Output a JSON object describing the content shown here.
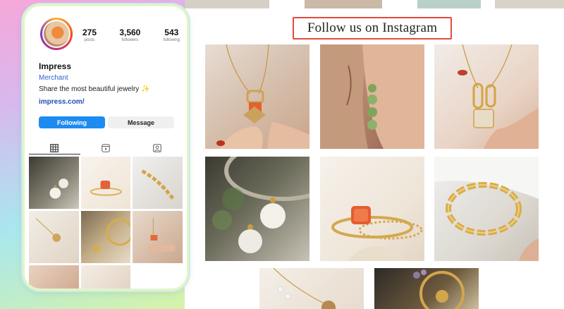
{
  "profile": {
    "stats": [
      {
        "value": "275",
        "label": "posts"
      },
      {
        "value": "3,560",
        "label": "followers"
      },
      {
        "value": "543",
        "label": "following"
      }
    ],
    "name": "Impress",
    "category": "Merchant",
    "bio": "Share the most beautiful jewelry",
    "bio_emoji": "✨",
    "link": "impress.com/",
    "buttons": {
      "following": "Following",
      "message": "Message"
    },
    "tabs": [
      {
        "icon": "grid-icon",
        "active": true
      },
      {
        "icon": "reels-icon",
        "active": false
      },
      {
        "icon": "tagged-icon",
        "active": false
      }
    ]
  },
  "section_title": "Follow us on Instagram",
  "colors": {
    "follow_button": "#1e8bf0",
    "title_border": "#e24a3c",
    "link": "#1f4fb3",
    "category": "#2b63c9"
  }
}
